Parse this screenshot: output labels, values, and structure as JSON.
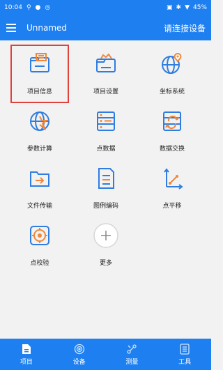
{
  "status_bar": {
    "time": "10:04",
    "battery": "45%"
  },
  "header": {
    "title": "Unnamed",
    "connect_label": "请连接设备"
  },
  "grid": {
    "items": [
      {
        "label": "项目信息",
        "icon": "project-info-icon"
      },
      {
        "label": "项目设置",
        "icon": "project-settings-icon"
      },
      {
        "label": "坐标系统",
        "icon": "coordinate-system-icon"
      },
      {
        "label": "参数计算",
        "icon": "parameter-calc-icon"
      },
      {
        "label": "点数据",
        "icon": "point-data-icon"
      },
      {
        "label": "数据交换",
        "icon": "data-exchange-icon"
      },
      {
        "label": "文件传输",
        "icon": "file-transfer-icon"
      },
      {
        "label": "图例编码",
        "icon": "legend-code-icon"
      },
      {
        "label": "点平移",
        "icon": "point-translate-icon"
      },
      {
        "label": "点校验",
        "icon": "point-check-icon"
      },
      {
        "label": "更多",
        "icon": "more-icon"
      }
    ]
  },
  "bottom_nav": {
    "items": [
      {
        "label": "项目",
        "icon": "project-tab-icon"
      },
      {
        "label": "设备",
        "icon": "device-tab-icon"
      },
      {
        "label": "测量",
        "icon": "measure-tab-icon"
      },
      {
        "label": "工具",
        "icon": "tools-tab-icon"
      }
    ]
  },
  "colors": {
    "primary": "#1e7ff0",
    "accent": "#f0873a",
    "selection": "#e0413c"
  }
}
